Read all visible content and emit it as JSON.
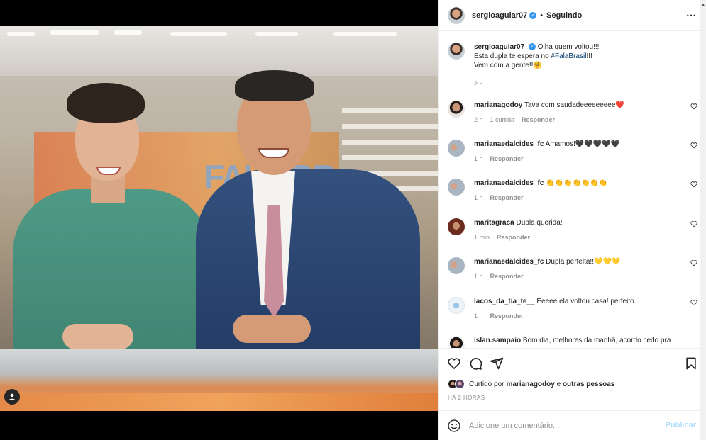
{
  "post": {
    "author": "sergioaguiar07",
    "follow_status": "Seguindo",
    "separator": "•",
    "more_icon": "⋯",
    "caption_line1_prefix": "Olha quem voltou!!!",
    "caption_line2_prefix": "Esta dupla te espera no ",
    "caption_hashtag": "#FalaBrasil",
    "caption_line2_suffix": "!!!",
    "caption_line3": "Vem com a gente!!🤗",
    "caption_time": "2 h"
  },
  "photo": {
    "screen_text": "FALA BR"
  },
  "comments": [
    {
      "user": "marianagodoy",
      "text": "Tava com saudadeeeeeeeee❤️",
      "time": "2 h",
      "likes": "1 curtida",
      "reply": "Responder"
    },
    {
      "user": "marianaedalcides_fc",
      "text": "Amamos!🖤🖤🖤🖤🖤",
      "time": "1 h",
      "reply": "Responder"
    },
    {
      "user": "marianaedalcides_fc",
      "text": "👏👏👏👏👏👏👏",
      "time": "1 h",
      "reply": "Responder"
    },
    {
      "user": "maritagraca",
      "text": "Dupla querida!",
      "time": "1 min",
      "reply": "Responder"
    },
    {
      "user": "marianaedalcides_fc",
      "text": "Dupla perfeita!!💛💛💛",
      "time": "1 h",
      "reply": "Responder"
    },
    {
      "user": "lacos_da_tia_te__",
      "text": "Eeeee ela voltou casa! perfeito",
      "time": "1 h",
      "reply": "Responder"
    },
    {
      "user": "islan.sampaio",
      "text": "Bom dia, melhores da manhã, acordo cedo pra"
    }
  ],
  "likes_line": {
    "prefix": "Curtido por ",
    "user": "marianagodoy",
    "middle": " e ",
    "others": "outras pessoas"
  },
  "time_ago": "HÁ 2 HORAS",
  "comment_input": {
    "placeholder": "Adicione um comentário...",
    "publish_label": "Publicar"
  },
  "icons": {
    "verified": "verified-badge",
    "like": "heart-icon",
    "comment": "comment-bubble-icon",
    "share": "paper-plane-icon",
    "save": "bookmark-icon",
    "emoji": "smiley-icon",
    "tagged": "user-tag-icon"
  },
  "colors": {
    "verified": "#3897f0",
    "link": "#00376b",
    "publish_disabled": "#b2dffc",
    "muted": "#8e8e8e"
  }
}
